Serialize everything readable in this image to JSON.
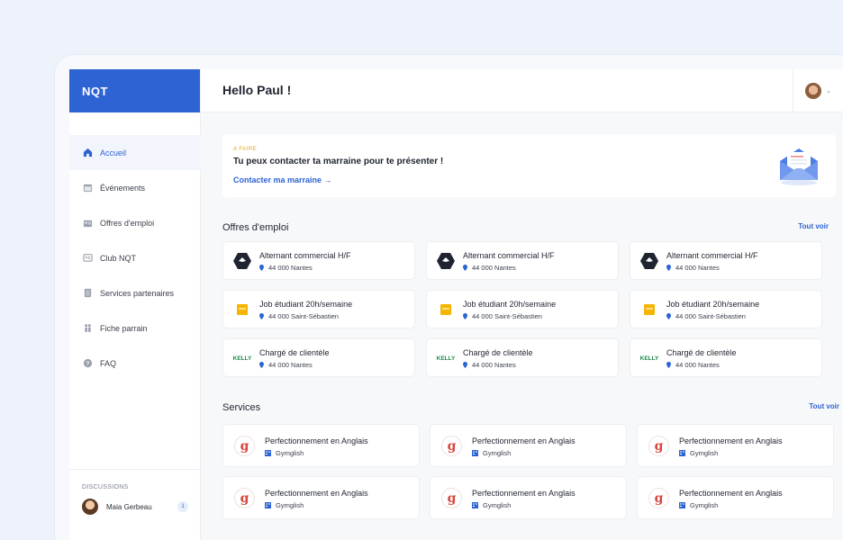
{
  "brand": {
    "logo_text": "NQT",
    "primary": "#2d63d3",
    "accent": "#e3a21a"
  },
  "header": {
    "greeting": "Hello Paul !"
  },
  "sidebar": {
    "items": [
      {
        "label": "Accueil",
        "icon": "home-icon"
      },
      {
        "label": "Événements",
        "icon": "calendar-icon"
      },
      {
        "label": "Offres d'emploi",
        "icon": "briefcase-icon"
      },
      {
        "label": "Club NQT",
        "icon": "club-icon"
      },
      {
        "label": "Services partenaires",
        "icon": "services-icon"
      },
      {
        "label": "Fiche parrain",
        "icon": "sponsor-icon"
      },
      {
        "label": "FAQ",
        "icon": "help-icon"
      }
    ],
    "discussions": {
      "title": "DISCUSSIONS",
      "contact": "Maia Gerbeau",
      "unread": "1"
    }
  },
  "banner": {
    "tag": "A FAIRE",
    "title": "Tu peux contacter ta marraine pour te présenter !",
    "link": "Contacter ma marraine →"
  },
  "jobs": {
    "title": "Offres d'emploi",
    "see_all": "Tout voir",
    "cards": [
      {
        "title": "Alternant commercial H/F",
        "location": "44 000 Nantes",
        "logo": "hexagon-logo"
      },
      {
        "title": "Alternant commercial H/F",
        "location": "44 000 Nantes",
        "logo": "hexagon-logo"
      },
      {
        "title": "Alternant commercial H/F",
        "location": "44 000 Nantes",
        "logo": "hexagon-logo"
      },
      {
        "title": "Job étudiant 20h/semaine",
        "location": "44 000 Saint-Sébastien",
        "logo": "yellow-logo"
      },
      {
        "title": "Job étudiant 20h/semaine",
        "location": "44 000 Saint-Sébastien",
        "logo": "yellow-logo"
      },
      {
        "title": "Job étudiant 20h/semaine",
        "location": "44 000 Saint-Sébastien",
        "logo": "yellow-logo"
      },
      {
        "title": "Chargé de clientèle",
        "location": "44 000 Nantes",
        "logo": "kelly-logo",
        "logo_text": "KELLY"
      },
      {
        "title": "Chargé de clientèle",
        "location": "44 000 Nantes",
        "logo": "kelly-logo",
        "logo_text": "KELLY"
      },
      {
        "title": "Chargé de clientèle",
        "location": "44 000 Nantes",
        "logo": "kelly-logo",
        "logo_text": "KELLY"
      }
    ]
  },
  "services": {
    "title": "Services",
    "see_all": "Tout voir",
    "cards": [
      {
        "title": "Perfectionnement en Anglais",
        "provider": "Gymglish",
        "logo_text": "g"
      },
      {
        "title": "Perfectionnement en Anglais",
        "provider": "Gymglish",
        "logo_text": "g"
      },
      {
        "title": "Perfectionnement en Anglais",
        "provider": "Gymglish",
        "logo_text": "g"
      },
      {
        "title": "Perfectionnement en Anglais",
        "provider": "Gymglish",
        "logo_text": "g"
      },
      {
        "title": "Perfectionnement en Anglais",
        "provider": "Gymglish",
        "logo_text": "g"
      },
      {
        "title": "Perfectionnement en Anglais",
        "provider": "Gymglish",
        "logo_text": "g"
      }
    ]
  }
}
